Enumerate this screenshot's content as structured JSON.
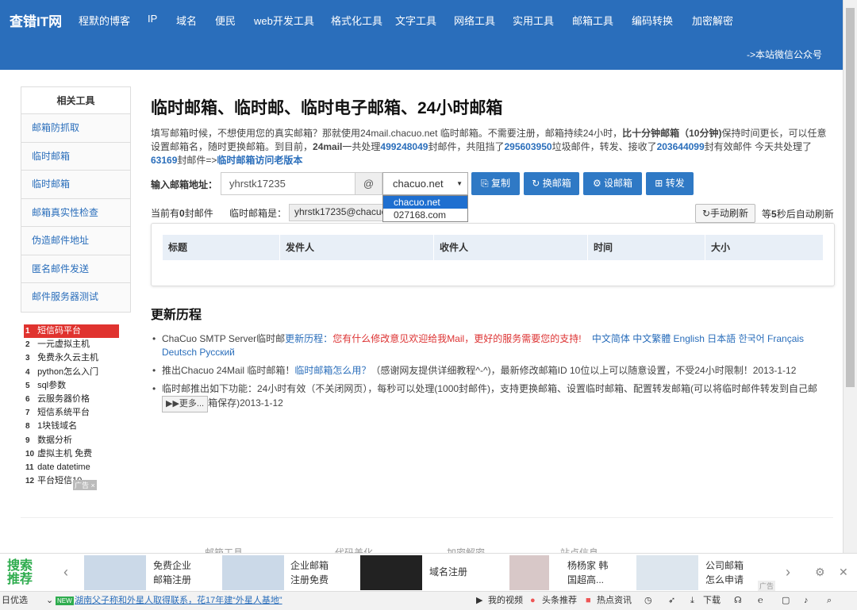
{
  "header": {
    "logo": "查错IT网",
    "nav": [
      "程默的博客",
      "IP",
      "域名",
      "便民",
      "web开发工具",
      "格式化工具",
      "文字工具",
      "网络工具",
      "实用工具",
      "邮箱工具",
      "编码转换",
      "加密解密"
    ],
    "wechat": "->本站微信公众号",
    "bg": "#2a6ebb"
  },
  "sidebar": {
    "title": "相关工具",
    "items": [
      "邮箱防抓取",
      "临时邮箱",
      "临时邮箱",
      "邮箱真实性检查",
      "伪造邮件地址",
      "匿名邮件发送",
      "邮件服务器测试"
    ]
  },
  "hotlist": [
    [
      "1",
      "短信码平台"
    ],
    [
      "2",
      "一元虚拟主机"
    ],
    [
      "3",
      "免费永久云主机"
    ],
    [
      "4",
      "python怎么入门"
    ],
    [
      "5",
      "sql参数"
    ],
    [
      "6",
      "云服务器价格"
    ],
    [
      "7",
      "短信系统平台"
    ],
    [
      "8",
      "1块钱域名"
    ],
    [
      "9",
      "数据分析"
    ],
    [
      "10",
      "虚拟主机 免费"
    ],
    [
      "11",
      "date datetime"
    ],
    [
      "12",
      "平台短信10"
    ]
  ],
  "ad_tag": "广告 ×",
  "main": {
    "title": "临时邮箱、临时邮、临时电子邮箱、24小时邮箱",
    "intro": {
      "p1": "填写邮箱时候，不想使用您的真实邮箱？那就使用24mail.chacuo.net 临时邮箱。不需要注册，邮箱持续24小时，",
      "p1b": "比十分钟邮箱（10分钟)",
      "p1c": "保持时间更长，可以任意设置邮箱名，随时更换邮箱。到目前，",
      "p1d": "24mail",
      "p1e": "一共处理",
      "n1": "499248049",
      "p1f": "封邮件，共阻挡了",
      "n2": "295603950",
      "p1g": "垃圾邮件，转发、接收了",
      "n3": "203644099",
      "p1h": "封有效邮件 今天共处理了",
      "n4": "63169",
      "p1i": "封邮件=>",
      "old": "临时邮箱访问老版本"
    },
    "form": {
      "label": "输入邮箱地址：",
      "value": "yhrstk17235",
      "at": "@",
      "domain": "chacuo.net",
      "options": [
        "chacuo.net",
        "027168.com"
      ],
      "copy": "复制",
      "change": "换邮箱",
      "set": "设邮箱",
      "forward": "转发"
    },
    "status": {
      "count_pre": "当前有",
      "count": "0",
      "count_post": "封邮件",
      "mail_label": "临时邮箱是：",
      "mail": "yhrstk17235@chacuo.net",
      "refresh": "手动刷新",
      "auto_pre": "等",
      "auto_n": "5",
      "auto_post": "秒后自动刷新"
    },
    "table": {
      "headers": [
        "标题",
        "发件人",
        "收件人",
        "时间",
        "大小"
      ]
    },
    "history": {
      "title": "更新历程",
      "i1a": "ChaCuo SMTP Server临时邮",
      "i1b": "更新历程：",
      "i1c": "您有什么修改意见欢迎给我Mail，更好的服务需要您的支持!",
      "langs": "中文简体  中文繁體  English  日本語  한국어  Français  Deutsch  Русский",
      "i2a": "推出Chacuo 24Mail 临时邮箱！",
      "i2b": "临时邮箱怎么用？",
      "i2c": "（感谢网友提供详细教程^-^)，最新修改邮箱ID 10位以上可以随意设置，不受24小时限制！2013-1-12",
      "i3a": "临时邮推出如下功能：24小时有效（不关闭网页），每秒可以处理(1000封邮件)，支持更换邮箱、设置临时邮箱、配置转发邮箱(可以将临时邮件转发到自己邮",
      "more": "▶▶更多...",
      "i3b": "箱保存)2013-1-12"
    }
  },
  "footer_ghost": [
    "邮箱工具",
    "代码美化",
    "加密解密",
    "站点信息"
  ],
  "adbar": {
    "logo1": "搜索",
    "logo2": "推荐",
    "items": [
      [
        "免费企业",
        "邮箱注册"
      ],
      [
        "企业邮箱",
        "注册免费"
      ],
      [
        "域名注册",
        ""
      ],
      [
        "杨杨家 韩",
        "国超高..."
      ],
      [
        "公司邮箱",
        "怎么申请"
      ]
    ],
    "tag": "广告"
  },
  "statusbar": {
    "left": "日优选",
    "news": "湖南父子称和外星人取得联系，花17年建“外星人基地”",
    "new": "NEW",
    "video": "我的视频",
    "toutiao": "头条推荐",
    "hot": "热点资讯",
    "download": "下载"
  }
}
